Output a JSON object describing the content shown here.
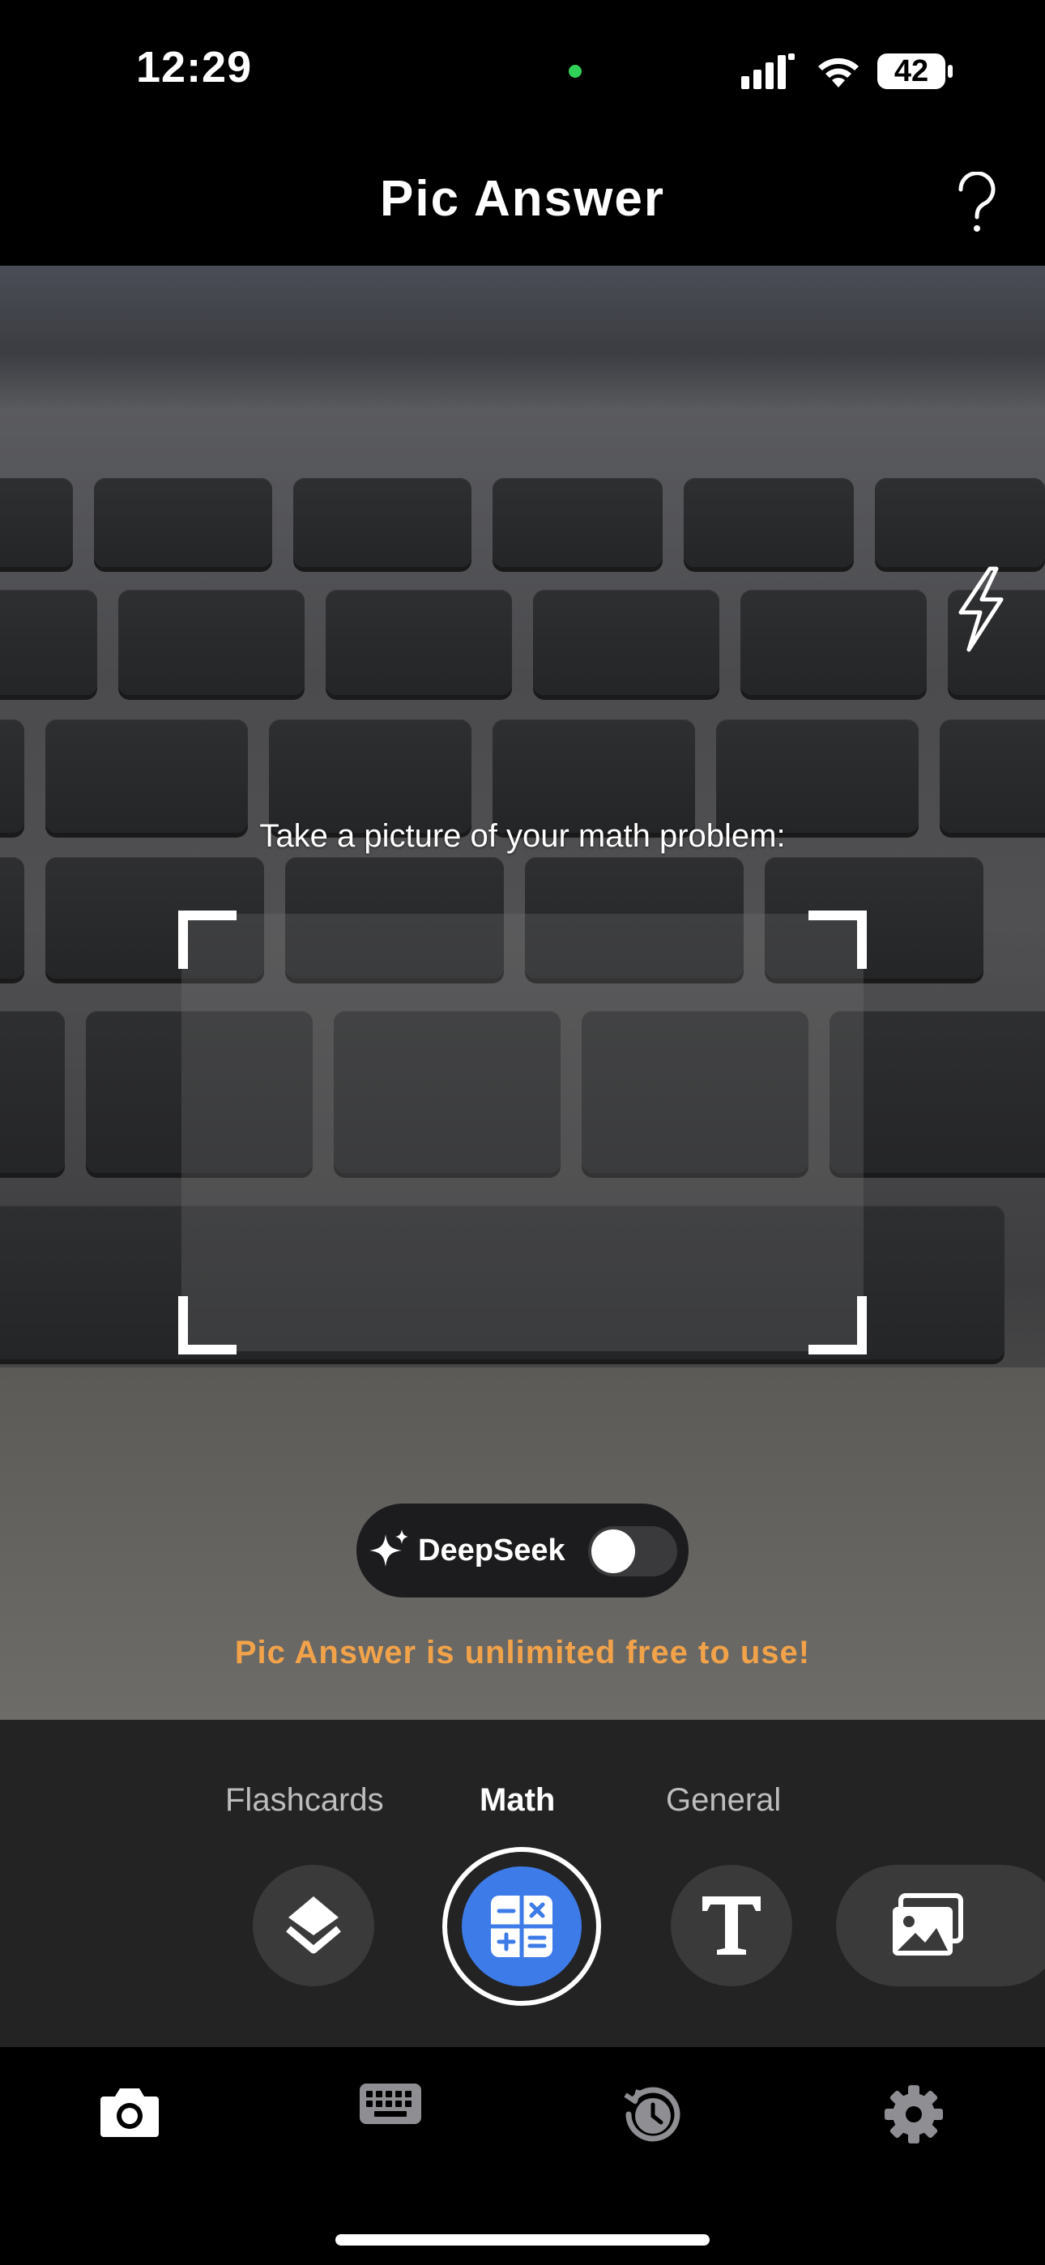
{
  "status_bar": {
    "time": "12:29",
    "battery": "42"
  },
  "header": {
    "title": "Pic Answer"
  },
  "camera": {
    "prompt": "Take a picture of your math problem:",
    "deepseek_label": "DeepSeek",
    "deepseek_enabled": false,
    "promo": "Pic Answer is unlimited free to use!"
  },
  "modes": {
    "tabs": [
      {
        "label": "Flashcards",
        "icon": "layers-icon"
      },
      {
        "label": "Math",
        "icon": "calculator-icon",
        "active": true
      },
      {
        "label": "General",
        "icon": "text-t-icon"
      }
    ],
    "gallery_icon": "photo-gallery-icon"
  },
  "tabbar": {
    "items": [
      {
        "icon": "camera-icon",
        "active": true
      },
      {
        "icon": "keyboard-icon"
      },
      {
        "icon": "history-icon"
      },
      {
        "icon": "settings-gear-icon"
      }
    ]
  },
  "colors": {
    "accent": "#3d7be8",
    "promo": "#f2a34a",
    "panel": "#232323"
  }
}
